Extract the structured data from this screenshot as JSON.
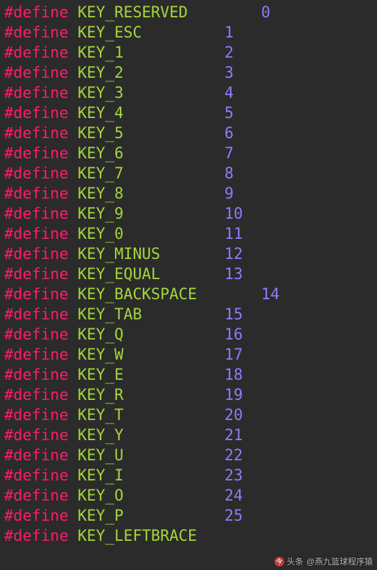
{
  "defines": [
    {
      "directive": "#define",
      "name": "KEY_RESERVED",
      "value": "0",
      "name_col": 8,
      "value_col": 28
    },
    {
      "directive": "#define",
      "name": "KEY_ESC",
      "value": "1",
      "name_col": 8,
      "value_col": 24
    },
    {
      "directive": "#define",
      "name": "KEY_1",
      "value": "2",
      "name_col": 8,
      "value_col": 24
    },
    {
      "directive": "#define",
      "name": "KEY_2",
      "value": "3",
      "name_col": 8,
      "value_col": 24
    },
    {
      "directive": "#define",
      "name": "KEY_3",
      "value": "4",
      "name_col": 8,
      "value_col": 24
    },
    {
      "directive": "#define",
      "name": "KEY_4",
      "value": "5",
      "name_col": 8,
      "value_col": 24
    },
    {
      "directive": "#define",
      "name": "KEY_5",
      "value": "6",
      "name_col": 8,
      "value_col": 24
    },
    {
      "directive": "#define",
      "name": "KEY_6",
      "value": "7",
      "name_col": 8,
      "value_col": 24
    },
    {
      "directive": "#define",
      "name": "KEY_7",
      "value": "8",
      "name_col": 8,
      "value_col": 24
    },
    {
      "directive": "#define",
      "name": "KEY_8",
      "value": "9",
      "name_col": 8,
      "value_col": 24
    },
    {
      "directive": "#define",
      "name": "KEY_9",
      "value": "10",
      "name_col": 8,
      "value_col": 24
    },
    {
      "directive": "#define",
      "name": "KEY_0",
      "value": "11",
      "name_col": 8,
      "value_col": 24
    },
    {
      "directive": "#define",
      "name": "KEY_MINUS",
      "value": "12",
      "name_col": 8,
      "value_col": 24
    },
    {
      "directive": "#define",
      "name": "KEY_EQUAL",
      "value": "13",
      "name_col": 8,
      "value_col": 24
    },
    {
      "directive": "#define",
      "name": "KEY_BACKSPACE",
      "value": "14",
      "name_col": 8,
      "value_col": 28
    },
    {
      "directive": "#define",
      "name": "KEY_TAB",
      "value": "15",
      "name_col": 8,
      "value_col": 24
    },
    {
      "directive": "#define",
      "name": "KEY_Q",
      "value": "16",
      "name_col": 8,
      "value_col": 24
    },
    {
      "directive": "#define",
      "name": "KEY_W",
      "value": "17",
      "name_col": 8,
      "value_col": 24
    },
    {
      "directive": "#define",
      "name": "KEY_E",
      "value": "18",
      "name_col": 8,
      "value_col": 24
    },
    {
      "directive": "#define",
      "name": "KEY_R",
      "value": "19",
      "name_col": 8,
      "value_col": 24
    },
    {
      "directive": "#define",
      "name": "KEY_T",
      "value": "20",
      "name_col": 8,
      "value_col": 24
    },
    {
      "directive": "#define",
      "name": "KEY_Y",
      "value": "21",
      "name_col": 8,
      "value_col": 24
    },
    {
      "directive": "#define",
      "name": "KEY_U",
      "value": "22",
      "name_col": 8,
      "value_col": 24
    },
    {
      "directive": "#define",
      "name": "KEY_I",
      "value": "23",
      "name_col": 8,
      "value_col": 24
    },
    {
      "directive": "#define",
      "name": "KEY_O",
      "value": "24",
      "name_col": 8,
      "value_col": 24
    },
    {
      "directive": "#define",
      "name": "KEY_P",
      "value": "25",
      "name_col": 8,
      "value_col": 24
    },
    {
      "directive": "#define",
      "name": "KEY_LEFTBRACE",
      "value": "",
      "name_col": 8,
      "value_col": 24
    }
  ],
  "watermark": {
    "brand": "头条",
    "handle": "@燕九篮球程序猿"
  }
}
